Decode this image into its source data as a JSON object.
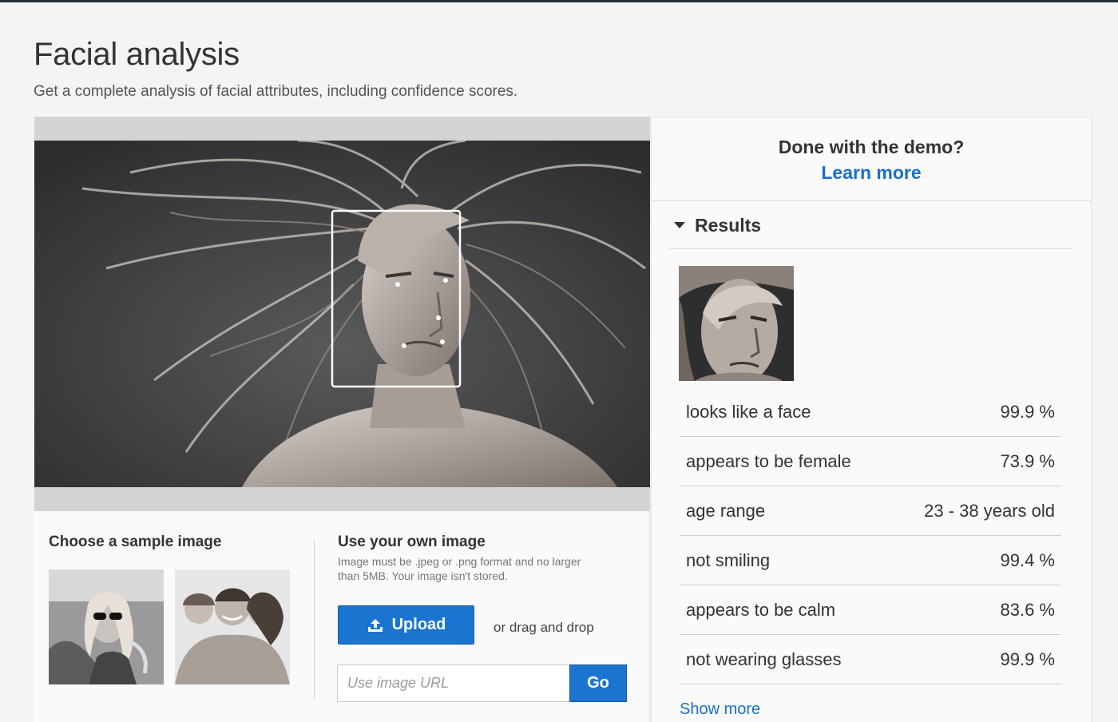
{
  "page": {
    "title": "Facial analysis",
    "subtitle": "Get a complete analysis of facial attributes, including confidence scores."
  },
  "samples": {
    "title": "Choose a sample image"
  },
  "own_image": {
    "title": "Use your own image",
    "description": "Image must be .jpeg or .png format and no larger than 5MB. Your image isn't stored.",
    "upload_label": "Upload",
    "drag_text": "or drag and drop",
    "url_placeholder": "Use image URL",
    "go_label": "Go"
  },
  "demo": {
    "question": "Done with the demo?",
    "learn_more": "Learn more"
  },
  "results": {
    "title": "Results",
    "rows": [
      {
        "label": "looks like a face",
        "value": "99.9 %"
      },
      {
        "label": "appears to be female",
        "value": "73.9 %"
      },
      {
        "label": "age range",
        "value": "23 - 38 years old"
      },
      {
        "label": "not smiling",
        "value": "99.4 %"
      },
      {
        "label": "appears to be calm",
        "value": "83.6 %"
      },
      {
        "label": "not wearing glasses",
        "value": "99.9 %"
      }
    ],
    "show_more": "Show more"
  },
  "colors": {
    "accent": "#1b75d0",
    "link": "#1a6fc9",
    "bounding_box": "#ffffff"
  },
  "icons": {
    "upload": "upload-icon",
    "results_toggle": "caret-down-icon"
  }
}
